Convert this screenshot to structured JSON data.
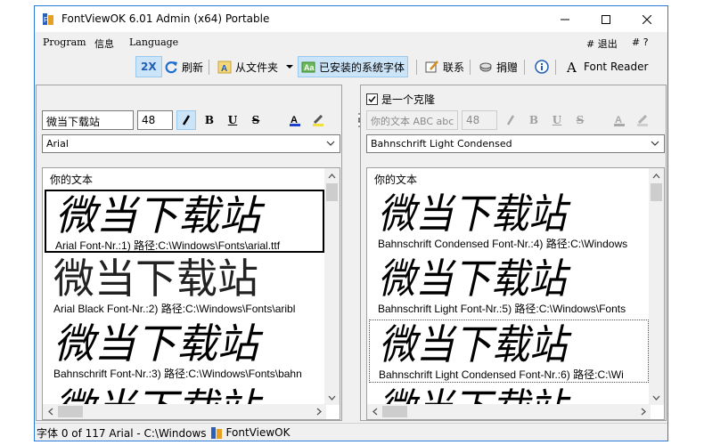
{
  "window": {
    "title": "FontViewOK 6.01 Admin (x64) Portable",
    "minimize_icon": "minimize-icon",
    "maximize_icon": "maximize-icon",
    "close_icon": "close-icon"
  },
  "menu": {
    "program": "Program",
    "info": "信息",
    "language": "Language",
    "exit": "# 退出",
    "help": "# ?"
  },
  "toolbar": {
    "zoom": "2X",
    "refresh": "刷新",
    "from_folder": "从文件夹",
    "installed_fonts": "已安装的系统字体",
    "contact": "联系",
    "donate": "捐赠",
    "font_reader": "Font Reader",
    "accent_color": "#1f5fb8",
    "active_bg": "#cce4f7"
  },
  "left_pane": {
    "sample_text": "微当下载站",
    "size": "48",
    "font_name": "Arial",
    "preview_label": "你的文本",
    "samples": [
      {
        "text": "微当下载站",
        "caption": "Arial Font-Nr.:1) 路径:C:\\Windows\\Fonts\\arial.ttf"
      },
      {
        "text": "微当下载站",
        "caption": "Arial Black Font-Nr.:2) 路径:C:\\Windows\\Fonts\\aribl"
      },
      {
        "text": "微当下载站",
        "caption": "Bahnschrift Font-Nr.:3) 路径:C:\\Windows\\Fonts\\bahn"
      },
      {
        "text": "微当下载站",
        "caption": ""
      }
    ]
  },
  "right_pane": {
    "clone_label": "是一个克隆",
    "sample_text": "你的文本 ABC abc",
    "size": "48",
    "font_name": "Bahnschrift Light Condensed",
    "preview_label": "你的文本",
    "samples": [
      {
        "text": "微当下载站",
        "caption": "Bahnschrift Condensed Font-Nr.:4) 路径:C:\\Windows"
      },
      {
        "text": "微当下载站",
        "caption": "Bahnschrift Light Font-Nr.:5) 路径:C:\\Windows\\Fonts"
      },
      {
        "text": "微当下载站",
        "caption": "Bahnschrift Light Condensed Font-Nr.:6) 路径:C:\\Wi"
      },
      {
        "text": "微当下载站",
        "caption": ""
      }
    ]
  },
  "status": {
    "text": "字体 0 of 117 Arial - C:\\Windows",
    "app": "FontViewOK"
  }
}
